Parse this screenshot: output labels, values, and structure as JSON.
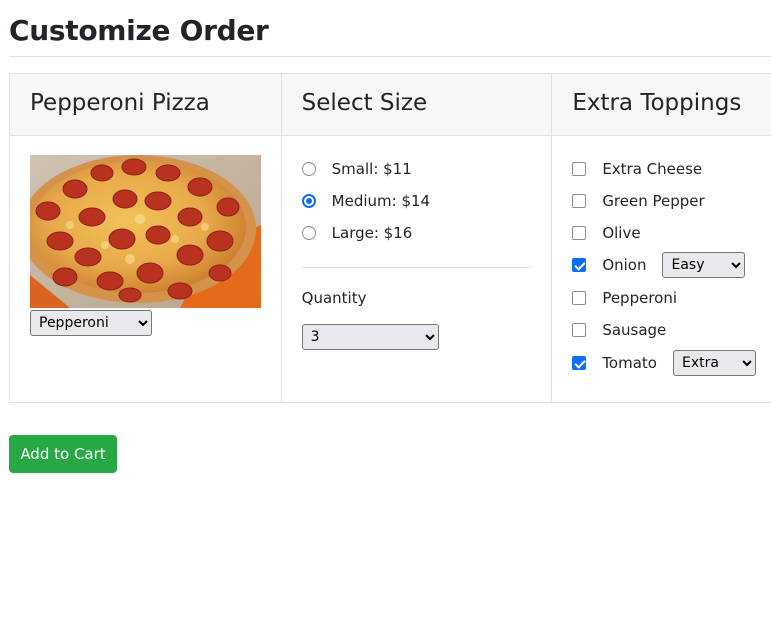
{
  "page": {
    "title": "Customize Order"
  },
  "pizza": {
    "name": "Pepperoni Pizza",
    "selected_type": "Pepperoni"
  },
  "size": {
    "heading": "Select Size",
    "options": [
      {
        "label": "Small: $11",
        "checked": false
      },
      {
        "label": "Medium: $14",
        "checked": true
      },
      {
        "label": "Large: $16",
        "checked": false
      }
    ],
    "quantity_label": "Quantity",
    "quantity_value": "3"
  },
  "toppings": {
    "heading": "Extra Toppings",
    "items": [
      {
        "label": "Extra Cheese",
        "checked": false,
        "amount": ""
      },
      {
        "label": "Green Pepper",
        "checked": false,
        "amount": ""
      },
      {
        "label": "Olive",
        "checked": false,
        "amount": ""
      },
      {
        "label": "Onion",
        "checked": true,
        "amount": "Easy"
      },
      {
        "label": "Pepperoni",
        "checked": false,
        "amount": ""
      },
      {
        "label": "Sausage",
        "checked": false,
        "amount": ""
      },
      {
        "label": "Tomato",
        "checked": true,
        "amount": "Extra"
      }
    ]
  },
  "actions": {
    "add_to_cart": "Add to Cart"
  },
  "colors": {
    "accent": "#0d6efd",
    "button": "#28a745",
    "header_bg": "#f7f7f7",
    "border": "#dee2e6"
  }
}
